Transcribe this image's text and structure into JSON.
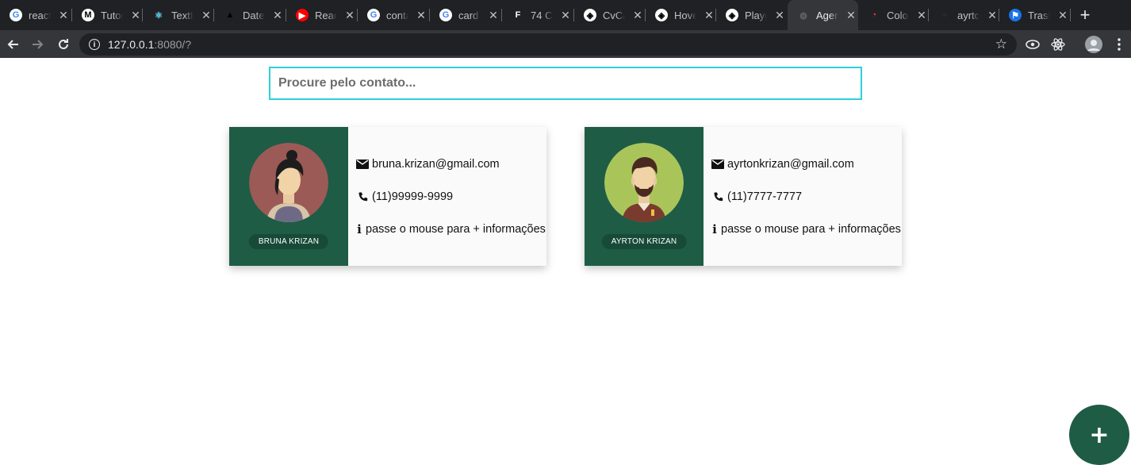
{
  "browser": {
    "tabs": [
      {
        "title": "react",
        "fav": "G",
        "favColor": "#ffffff",
        "favBg": "#ffffff",
        "favText": "#4285f4"
      },
      {
        "title": "Tutor",
        "fav": "M",
        "favColor": "#000",
        "favBg": "#ffffff",
        "favText": "#000000"
      },
      {
        "title": "TextI",
        "fav": "⚛",
        "favBg": "transparent",
        "favText": "#61dafb"
      },
      {
        "title": "Date",
        "fav": "▲",
        "favBg": "transparent",
        "favText": "#000000"
      },
      {
        "title": "Reac",
        "fav": "▶",
        "favBg": "#ff0000",
        "favText": "#ffffff"
      },
      {
        "title": "conta",
        "fav": "G",
        "favBg": "#ffffff",
        "favText": "#4285f4"
      },
      {
        "title": "card",
        "fav": "G",
        "favBg": "#ffffff",
        "favText": "#4285f4"
      },
      {
        "title": "74 C",
        "fav": "F",
        "favBg": "transparent",
        "favText": "#ffffff"
      },
      {
        "title": "CvCa",
        "fav": "◈",
        "favBg": "#ffffff",
        "favText": "#000000"
      },
      {
        "title": "Hove",
        "fav": "◈",
        "favBg": "#ffffff",
        "favText": "#000000"
      },
      {
        "title": "Playg",
        "fav": "◈",
        "favBg": "#ffffff",
        "favText": "#000000"
      },
      {
        "title": "Agen",
        "fav": "◍",
        "favBg": "transparent",
        "favText": "#5f6368",
        "active": true
      },
      {
        "title": "Colo",
        "fav": "◔",
        "favBg": "transparent",
        "favText": "#ff3b30"
      },
      {
        "title": "ayrto",
        "fav": "●",
        "favBg": "transparent",
        "favText": "#24292e"
      },
      {
        "title": "Trasl",
        "fav": "⚑",
        "favBg": "#1a73e8",
        "favText": "#ffffff"
      }
    ],
    "url_host": "127.0.0.1",
    "url_path": ":8080/?"
  },
  "search": {
    "placeholder": "Procure pelo contato...",
    "value": ""
  },
  "contacts": [
    {
      "name": "BRUNA KRIZAN",
      "email": "bruna.krizan@gmail.com",
      "phone": "(11)99999-9999",
      "info": "passe o mouse para + informações",
      "avatar_icon": "female-avatar-icon",
      "avatar_bg": "#9b5a56"
    },
    {
      "name": "AYRTON KRIZAN",
      "email": "ayrtonkrizan@gmail.com",
      "phone": "(11)7777-7777",
      "info": "passe o mouse para + informações",
      "avatar_icon": "male-avatar-icon",
      "avatar_bg": "#a9c55a"
    }
  ],
  "fab": {
    "label": "+"
  },
  "colors": {
    "accent": "#1e5c46",
    "search_border": "#2ed0d8"
  }
}
